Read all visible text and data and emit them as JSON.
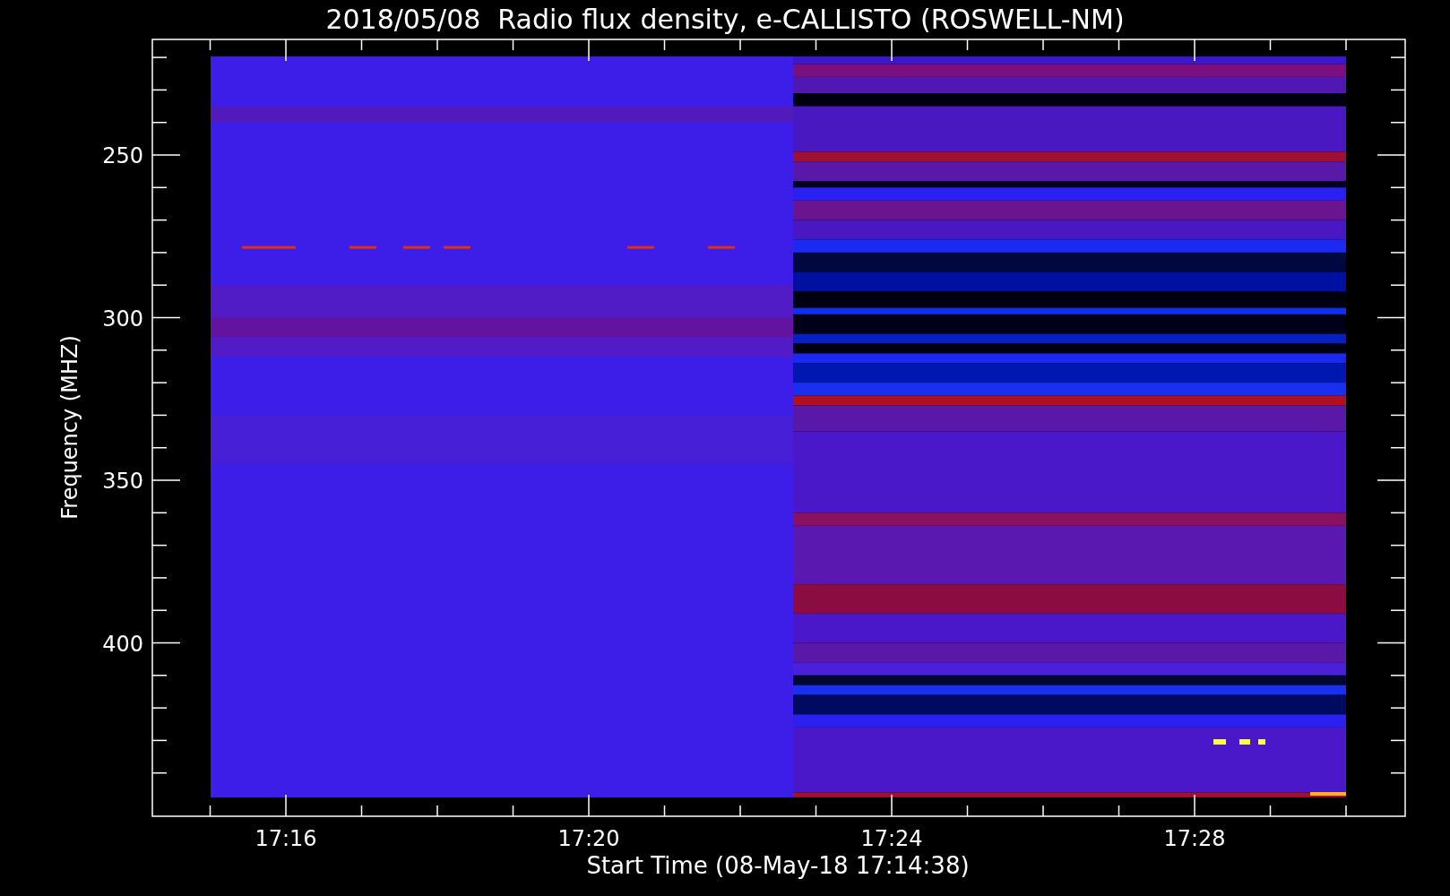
{
  "title": "2018/05/08  Radio flux density, e-CALLISTO (ROSWELL-NM)",
  "plot": {
    "xlabel": "Start Time (08-May-18 17:14:38)",
    "ylabel": "Frequency (MHZ)",
    "xtick_labels": [
      "17:16",
      "17:20",
      "17:24",
      "17:28"
    ],
    "ytick_labels": [
      "250",
      "300",
      "350",
      "400"
    ]
  }
}
